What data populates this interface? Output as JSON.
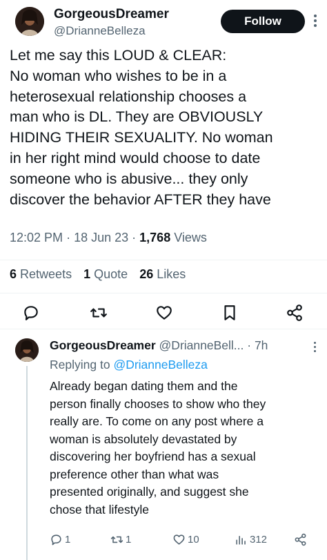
{
  "main_tweet": {
    "display_name": "GorgeousDreamer",
    "handle": "@DrianneBelleza",
    "follow_label": "Follow",
    "text_lines": [
      "Let me say this LOUD & CLEAR:",
      "No woman who wishes to be in a",
      "heterosexual relationship chooses a",
      "man who is DL. They are OBVIOUSLY",
      "HIDING THEIR SEXUALITY.  No woman",
      "in her right mind would choose to date",
      "someone who is abusive... they only",
      "discover the behavior AFTER they have"
    ],
    "time": "12:02 PM",
    "date": "18 Jun 23",
    "views_count": "1,768",
    "views_label": "Views",
    "retweets_count": "6",
    "retweets_label": "Retweets",
    "quotes_count": "1",
    "quotes_label": "Quote",
    "likes_count": "26",
    "likes_label": "Likes"
  },
  "reply_tweet": {
    "display_name": "GorgeousDreamer",
    "handle": "@DrianneBell...",
    "time_ago": "· 7h",
    "replying_to_label": "Replying to",
    "replying_to_handle": "@DrianneBelleza",
    "text_lines": [
      "Already began dating them and the",
      "person finally chooses to show who they",
      "really are. To come on any post where a",
      "woman is absolutely devastated by",
      "discovering  her boyfriend has a sexual",
      "preference other than what was",
      "presented originally, and suggest she",
      "chose that lifestyle"
    ],
    "reply_count": "1",
    "retweet_count": "1",
    "like_count": "10",
    "views_count": "312"
  },
  "icons": {
    "reply": "reply-icon",
    "retweet": "retweet-icon",
    "like": "heart-icon",
    "bookmark": "bookmark-icon",
    "share": "share-icon",
    "views": "views-icon",
    "more": "more-icon"
  },
  "colors": {
    "text": "#0f1419",
    "secondary": "#536471",
    "link": "#1d9bf0",
    "follow_bg": "#0f1419"
  }
}
